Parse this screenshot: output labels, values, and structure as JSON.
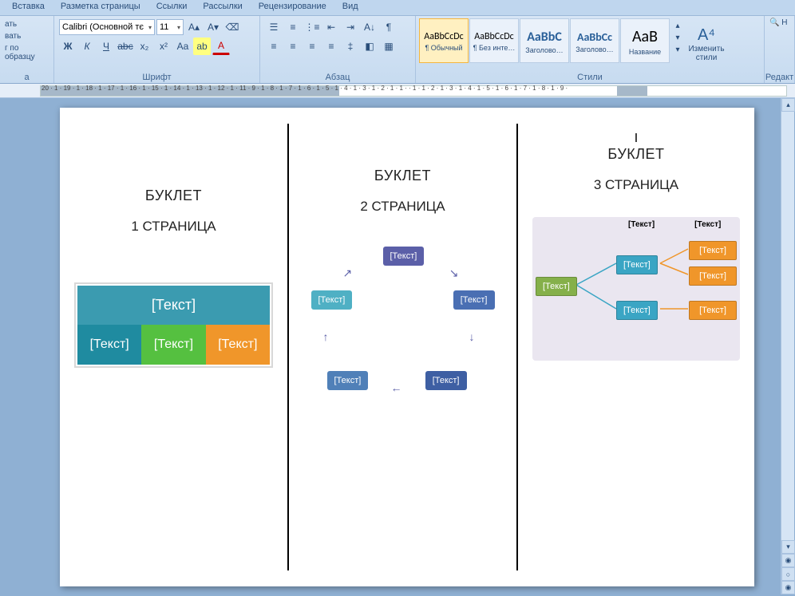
{
  "tabs": [
    "Вставка",
    "Разметка страницы",
    "Ссылки",
    "Рассылки",
    "Рецензирование",
    "Вид"
  ],
  "clipboard": {
    "line1": "ать",
    "line2": "вать",
    "line3": "г по образцу",
    "line4": "а"
  },
  "font": {
    "name": "Calibri (Основной тє",
    "size": "11",
    "group_label": "Шрифт",
    "bold": "Ж",
    "italic": "К",
    "underline": "Ч",
    "strike": "abє",
    "sub": "x₂",
    "sup": "x²",
    "case": "Aa",
    "highlight": "ab",
    "color": "A"
  },
  "paragraph": {
    "group_label": "Абзац"
  },
  "styles": {
    "group_label": "Стили",
    "items": [
      {
        "preview": "AaBbCcDc",
        "name": "¶ Обычный",
        "sel": true,
        "size": "12px",
        "color": "#000"
      },
      {
        "preview": "AaBbCcDc",
        "name": "¶ Без инте…",
        "sel": false,
        "size": "12px",
        "color": "#000"
      },
      {
        "preview": "AaBbC",
        "name": "Заголово…",
        "sel": false,
        "size": "16px",
        "color": "#2a6099",
        "weight": "bold"
      },
      {
        "preview": "AaBbCc",
        "name": "Заголово…",
        "sel": false,
        "size": "14px",
        "color": "#2a6099",
        "weight": "bold"
      },
      {
        "preview": "АаВ",
        "name": "Название",
        "sel": false,
        "size": "20px",
        "color": "#000"
      }
    ],
    "change": "Изменить\nстили",
    "edit": "Редакт",
    "find": "Н"
  },
  "ruler_numbers": "20 · 1 · 19 · 1 · 18 · 1 · 17 · 1 · 16 · 1 · 15 · 1 · 14 · 1 · 13 · 1 · 12 · 1 · 11                    · 9 · 1 · 8 · 1 · 7 · 1 · 6 · 1 · 5 · 1 · 4 · 1 · 3 · 1 · 2 · 1 · 1 ·         · 1 · 1 · 2 · 1 · 3 · 1 · 4 · 1 · 5 · 1 · 6 · 1 · 7 · 1 · 8 · 1 · 9 ·",
  "page": {
    "col1": {
      "title": "БУКЛЕТ",
      "sub": "1 СТРАНИЦА",
      "sm_head": "[Текст]",
      "c1": "[Текст]",
      "c2": "[Текст]",
      "c3": "[Текст]"
    },
    "col2": {
      "title": "БУКЛЕТ",
      "sub": "2 СТРАНИЦА",
      "n1": "[Текст]",
      "n2": "[Текст]",
      "n3": "[Текст]",
      "n4": "[Текст]",
      "n5": "[Текст]"
    },
    "col3": {
      "marker": "I",
      "title": "БУКЛЕТ",
      "sub": "3 СТРАНИЦА",
      "lbl1": "[Текст]",
      "lbl2": "[Текст]",
      "root": "[Текст]",
      "m1": "[Текст]",
      "m2": "[Текст]",
      "leaf1": "[Текст]",
      "leaf2": "[Текст]",
      "leaf3": "[Текст]"
    }
  }
}
